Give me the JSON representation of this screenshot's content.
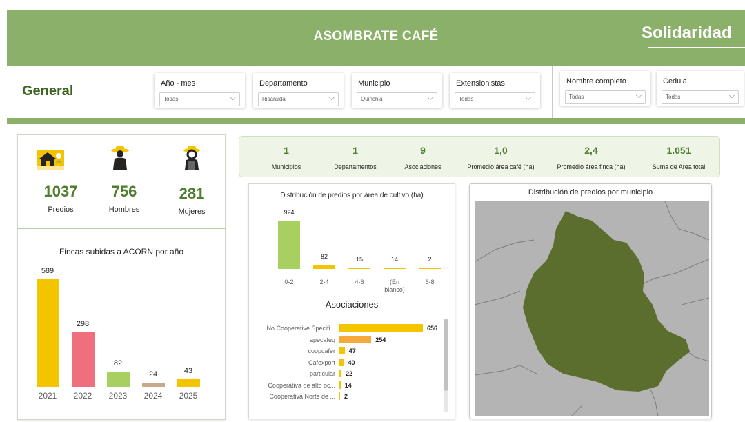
{
  "header": {
    "title": "ASOMBRATE CAFÉ",
    "brand": "Solidaridad"
  },
  "page_title": "General",
  "filters": [
    {
      "label": "Año - mes",
      "value": "Todas"
    },
    {
      "label": "Departamento",
      "value": "Risaralda"
    },
    {
      "label": "Municipio",
      "value": "Quinchia"
    },
    {
      "label": "Extensionistas",
      "value": "Todas"
    },
    {
      "label": "Nombre completo",
      "value": "Todas"
    },
    {
      "label": "Cedula",
      "value": "Todas"
    }
  ],
  "people": [
    {
      "icon": "farm-house-icon",
      "value": "1037",
      "label": "Predios"
    },
    {
      "icon": "farmer-man-icon",
      "value": "756",
      "label": "Hombres"
    },
    {
      "icon": "farmer-woman-icon",
      "value": "281",
      "label": "Mujeres"
    }
  ],
  "summary_kpis": [
    {
      "value": "1",
      "label": "Municipios"
    },
    {
      "value": "1",
      "label": "Departamentos"
    },
    {
      "value": "9",
      "label": "Asociaciones"
    },
    {
      "value": "1,0",
      "label": "Promedio área café (ha)"
    },
    {
      "value": "2,4",
      "label": "Promedio área finca (ha)"
    },
    {
      "value": "1.051",
      "label": "Suma de Area total"
    }
  ],
  "map": {
    "title": "Distribución de predios por municipio",
    "colors": {
      "region": "#5b6e2e",
      "background": "#b4b4b4",
      "border": "#7d7d7d"
    }
  },
  "chart_data": [
    {
      "type": "bar",
      "title": "Fincas subidas a ACORN por año",
      "categories": [
        "2021",
        "2022",
        "2023",
        "2024",
        "2025"
      ],
      "values": [
        589,
        298,
        82,
        24,
        43
      ],
      "colors": [
        "#f5c400",
        "#ef6f7d",
        "#a8d060",
        "#c9a98a",
        "#f5c400"
      ]
    },
    {
      "type": "bar",
      "title": "Distribución de predios por área de cultivo (ha)",
      "categories": [
        "0-2",
        "2-4",
        "4-6",
        "(En blanco)",
        "6-8"
      ],
      "values": [
        924,
        82,
        15,
        14,
        2
      ],
      "colors": [
        "#a8d060",
        "#f5c400",
        "#f5c400",
        "#f5c400",
        "#f5c400"
      ]
    },
    {
      "type": "bar",
      "orientation": "horizontal",
      "title": "Asociaciones",
      "categories": [
        "No Cooperative Specifi...",
        "apecafeq",
        "coopcafer",
        "Cafexport",
        "particular",
        "Cooperativa de alto oc...",
        "Cooperativa Norte de ..."
      ],
      "values": [
        656,
        254,
        47,
        40,
        22,
        14,
        2
      ],
      "colors": [
        "#f5c400",
        "#f5a93b",
        "#f5c400",
        "#f5c400",
        "#f5c400",
        "#f5c400",
        "#f5c400"
      ]
    }
  ]
}
